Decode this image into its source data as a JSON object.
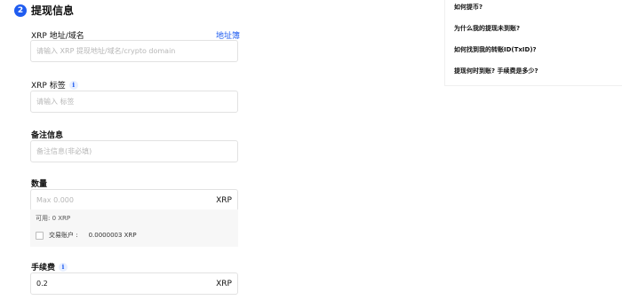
{
  "section": {
    "step": "2",
    "title": "提现信息"
  },
  "address": {
    "label": "XRP 地址/域名",
    "link": "地址簿",
    "placeholder": "请输入 XRP 提现地址/域名/crypto domain"
  },
  "tag": {
    "label": "XRP 标签",
    "info": "i",
    "placeholder": "请输入 标签"
  },
  "memo": {
    "label": "备注信息",
    "placeholder": "备注信息(非必填)"
  },
  "amount": {
    "label": "数量",
    "placeholder": "Max 0.000",
    "unit": "XRP",
    "available": "可用:  0 XRP",
    "account_label": "交易账户 :",
    "account_value": "0.0000003 XRP"
  },
  "fee": {
    "label": "手续费",
    "info": "i",
    "value": "0.2",
    "unit": "XRP"
  },
  "faq": {
    "items": [
      "如何提币?",
      "为什么我的提现未到账?",
      "如何找到我的转账ID(TxID)?",
      "提现何时到账? 手续费是多少?"
    ]
  },
  "colors": {
    "accent": "#1f5cf0",
    "border": "#e2e2e2",
    "panel": "#f7f7f7"
  }
}
